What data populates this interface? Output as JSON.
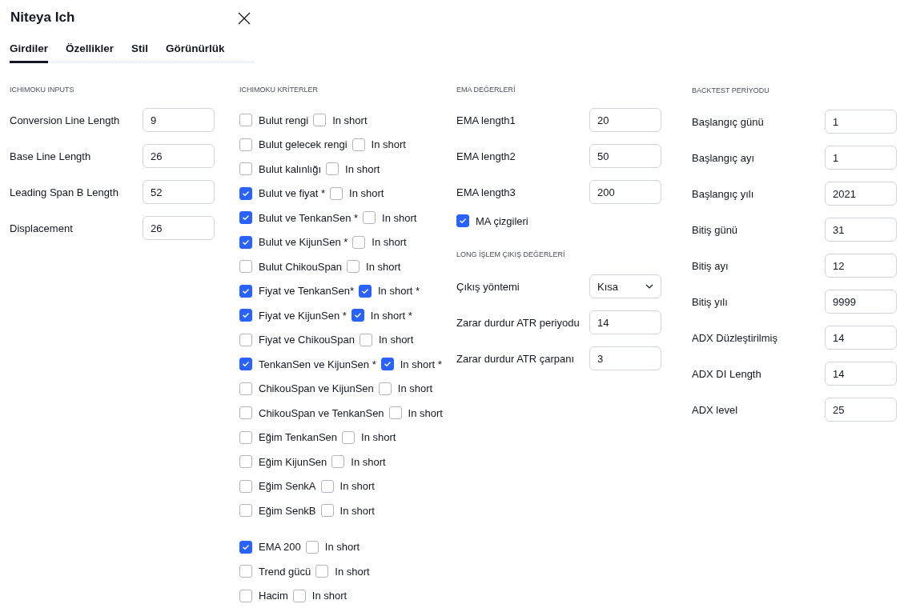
{
  "dialog": {
    "title": "Niteya Ich"
  },
  "tabs": [
    {
      "label": "Girdiler",
      "selected": true
    },
    {
      "label": "Özellikler",
      "selected": false
    },
    {
      "label": "Stil",
      "selected": false
    },
    {
      "label": "Görünürlük",
      "selected": false
    }
  ],
  "columns": [
    {
      "sections": [
        {
          "heading": "ICHIMOKU INPUTS",
          "items": [
            {
              "kind": "field",
              "label": "Conversion Line Length",
              "value": "9"
            },
            {
              "kind": "field",
              "label": "Base Line Length",
              "value": "26"
            },
            {
              "kind": "field",
              "label": "Leading Span B Length",
              "value": "52"
            },
            {
              "kind": "field",
              "label": "Displacement",
              "value": "26"
            }
          ]
        }
      ]
    },
    {
      "sections": [
        {
          "heading": "ICHIMOKU KRİTERLER",
          "items": [
            {
              "kind": "check_pair",
              "label": "Bulut rengi",
              "checked": false,
              "short_label": "In short",
              "short_checked": false
            },
            {
              "kind": "check_pair",
              "label": "Bulut gelecek rengi",
              "checked": false,
              "short_label": "In short",
              "short_checked": false
            },
            {
              "kind": "check_pair",
              "label": "Bulut kalınlığı",
              "checked": false,
              "short_label": "In short",
              "short_checked": false
            },
            {
              "kind": "check_pair",
              "label": "Bulut ve fiyat *",
              "checked": true,
              "short_label": "In short",
              "short_checked": false
            },
            {
              "kind": "check_pair",
              "label": "Bulut ve TenkanSen *",
              "checked": true,
              "short_label": "In short",
              "short_checked": false
            },
            {
              "kind": "check_pair",
              "label": "Bulut ve KijunSen *",
              "checked": true,
              "short_label": "In short",
              "short_checked": false
            },
            {
              "kind": "check_pair",
              "label": "Bulut ChikouSpan",
              "checked": false,
              "short_label": "In short",
              "short_checked": false
            },
            {
              "kind": "check_pair",
              "label": "Fiyat ve TenkanSen*",
              "checked": true,
              "short_label": "In short *",
              "short_checked": true
            },
            {
              "kind": "check_pair",
              "label": "Fiyat ve KijunSen *",
              "checked": true,
              "short_label": "In short *",
              "short_checked": true
            },
            {
              "kind": "check_pair",
              "label": "Fiyat ve ChikouSpan",
              "checked": false,
              "short_label": "In short",
              "short_checked": false
            },
            {
              "kind": "check_pair",
              "label": "TenkanSen ve KijunSen *",
              "checked": true,
              "short_label": "In short *",
              "short_checked": true
            },
            {
              "kind": "check_pair",
              "label": "ChikouSpan ve KijunSen",
              "checked": false,
              "short_label": "In short",
              "short_checked": false
            },
            {
              "kind": "check_pair",
              "label": "ChikouSpan ve TenkanSen",
              "checked": false,
              "short_label": "In short",
              "short_checked": false
            },
            {
              "kind": "check_pair",
              "label": "Eğim TenkanSen",
              "checked": false,
              "short_label": "In short",
              "short_checked": false
            },
            {
              "kind": "check_pair",
              "label": "Eğim KijunSen",
              "checked": false,
              "short_label": "In short",
              "short_checked": false
            },
            {
              "kind": "check_pair",
              "label": "Eğim SenkA",
              "checked": false,
              "short_label": "In short",
              "short_checked": false
            },
            {
              "kind": "check_pair",
              "label": "Eğim SenkB",
              "checked": false,
              "short_label": "In short",
              "short_checked": false
            }
          ]
        },
        {
          "items": [
            {
              "kind": "check_pair",
              "label": "EMA 200",
              "checked": true,
              "short_label": "In short",
              "short_checked": false
            },
            {
              "kind": "check_pair",
              "label": "Trend gücü",
              "checked": false,
              "short_label": "In short",
              "short_checked": false
            },
            {
              "kind": "check_pair",
              "label": "Hacim",
              "checked": false,
              "short_label": "In short",
              "short_checked": false
            }
          ]
        }
      ]
    },
    {
      "sections": [
        {
          "heading": "EMA DEĞERLERİ",
          "items": [
            {
              "kind": "field",
              "label": "EMA length1",
              "value": "20"
            },
            {
              "kind": "field",
              "label": "EMA length2",
              "value": "50"
            },
            {
              "kind": "field",
              "label": "EMA length3",
              "value": "200"
            },
            {
              "kind": "checkbox",
              "label": "MA çizgileri",
              "checked": true
            }
          ]
        },
        {
          "heading": "LONG İŞLEM ÇIKIŞ DEĞERLERİ",
          "items": [
            {
              "kind": "select",
              "label": "Çıkış yöntemi",
              "value": "Kısa"
            },
            {
              "kind": "field",
              "label": "Zarar durdur ATR periyodu",
              "value": "14"
            },
            {
              "kind": "field",
              "label": "Zarar durdur ATR çarpanı",
              "value": "3"
            }
          ]
        }
      ]
    },
    {
      "sections": [
        {
          "heading": "BACKTEST PERİYODU",
          "items": [
            {
              "kind": "field",
              "label": "Başlangıç günü",
              "value": "1"
            },
            {
              "kind": "field",
              "label": "Başlangıç ayı",
              "value": "1"
            },
            {
              "kind": "field",
              "label": "Başlangıç yılı",
              "value": "2021"
            },
            {
              "kind": "field",
              "label": "Bitiş günü",
              "value": "31"
            },
            {
              "kind": "field",
              "label": "Bitiş ayı",
              "value": "12"
            },
            {
              "kind": "field",
              "label": "Bitiş yılı",
              "value": "9999"
            }
          ]
        },
        {
          "items": [
            {
              "kind": "field",
              "label": "ADX Düzleştirilmiş",
              "value": "14"
            },
            {
              "kind": "field",
              "label": "ADX DI Length",
              "value": "14"
            },
            {
              "kind": "field",
              "label": "ADX level",
              "value": "25"
            }
          ]
        }
      ]
    }
  ]
}
